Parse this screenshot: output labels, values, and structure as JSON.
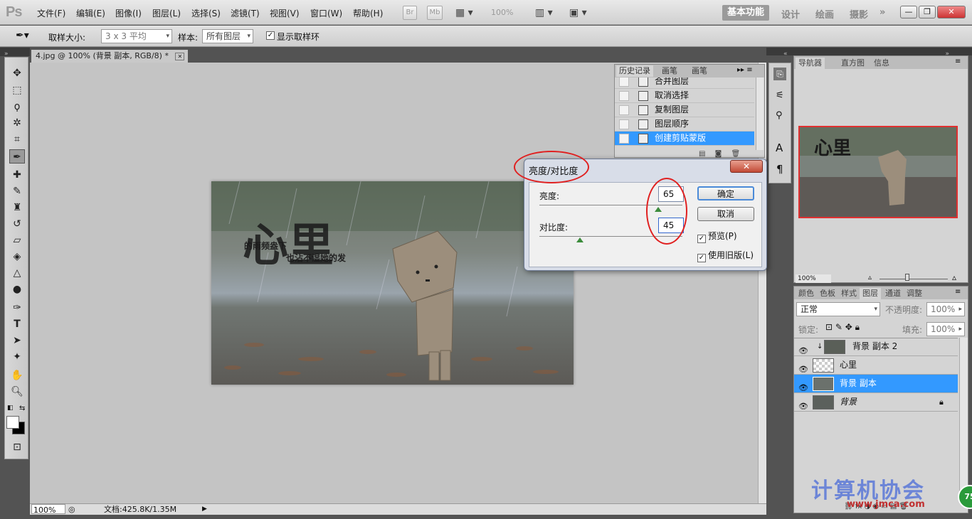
{
  "app": {
    "logo": "Ps"
  },
  "menu": [
    "文件(F)",
    "编辑(E)",
    "图像(I)",
    "图层(L)",
    "选择(S)",
    "滤镜(T)",
    "视图(V)",
    "窗口(W)",
    "帮助(H)"
  ],
  "appbar": {
    "br": "Br",
    "mb": "Mb",
    "zoom": "100%"
  },
  "workspaces": {
    "active": "基本功能",
    "items": [
      "设计",
      "绘画",
      "摄影"
    ],
    "more": "»"
  },
  "window_controls": {
    "min": "—",
    "restore": "❐",
    "close": "✕"
  },
  "options": {
    "sample_size_label": "取样大小:",
    "sample_size_value": "3 x 3 平均",
    "sample_label": "样本:",
    "sample_value": "所有图层",
    "show_ring_label": "显示取样环",
    "show_ring_checked": true
  },
  "document": {
    "tab_title": "4.jpg @ 100% (背景 副本, RGB/8) *",
    "close": "✕",
    "photo_text_big": "心里",
    "photo_text_line1": "的雨频盎下",
    "photo_text_line2": "也沾不湿她的发"
  },
  "statusbar": {
    "zoom": "100%",
    "doc_info": "文档:425.8K/1.35M"
  },
  "history": {
    "tabs": [
      "历史记录",
      "画笔预设",
      "画笔"
    ],
    "items": [
      {
        "label": "合并图层",
        "selected": false
      },
      {
        "label": "取消选择",
        "selected": false
      },
      {
        "label": "复制图层",
        "selected": false
      },
      {
        "label": "图层顺序",
        "selected": false
      },
      {
        "label": "创建剪贴蒙版",
        "selected": true
      }
    ]
  },
  "dialog": {
    "title": "亮度/对比度",
    "close": "✕",
    "brightness_label": "亮度:",
    "brightness_value": "65",
    "contrast_label": "对比度:",
    "contrast_value": "45",
    "ok": "确定",
    "cancel": "取消",
    "preview_label": "预览(P)",
    "preview_checked": true,
    "legacy_label": "使用旧版(L)",
    "legacy_checked": true
  },
  "navigator": {
    "tabs": [
      "导航器",
      "直方图",
      "信息"
    ],
    "zoom": "100%"
  },
  "layers": {
    "tabs": [
      "颜色",
      "色板",
      "样式",
      "图层",
      "通道",
      "调整"
    ],
    "blend_mode": "正常",
    "opacity_label": "不透明度:",
    "opacity_value": "100%",
    "lock_label": "锁定:",
    "fill_label": "填充:",
    "fill_value": "100%",
    "items": [
      {
        "name": "背景 副本 2",
        "selected": false
      },
      {
        "name": "心里",
        "selected": false
      },
      {
        "name": "背景 副本",
        "selected": true
      },
      {
        "name": "背景",
        "selected": false
      }
    ]
  },
  "watermark": {
    "text": "计算机协会",
    "url": "www.jmca.com",
    "badge": "75"
  },
  "colors": {
    "selection": "#3399ff",
    "annotation": "#e02020",
    "dialog_frame": "#d8dde8"
  }
}
